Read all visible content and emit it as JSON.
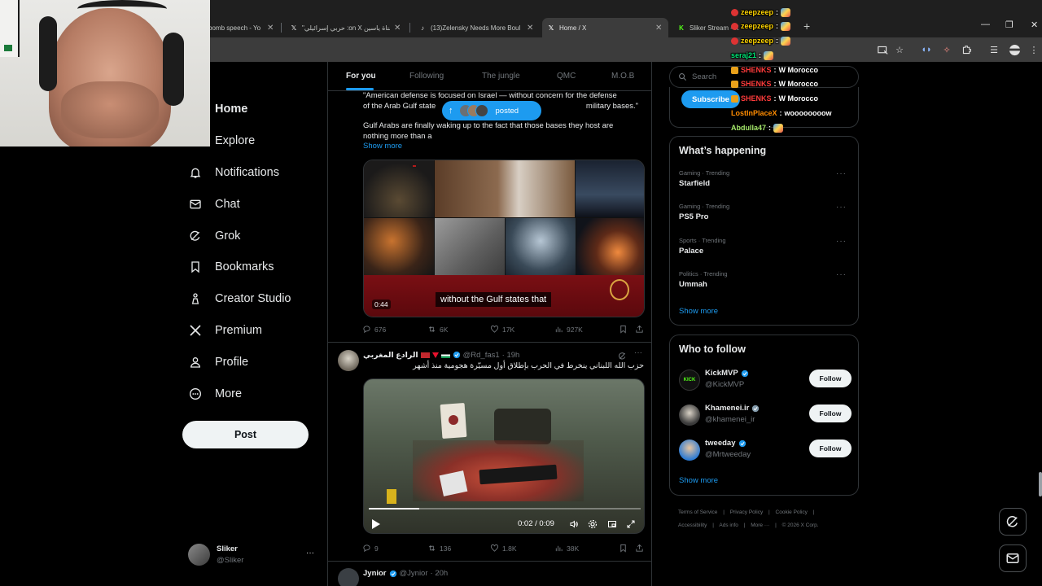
{
  "browser": {
    "tabs": [
      {
        "label": "bomb speech - Yo",
        "favicon": "youtube-icon"
      },
      {
        "label": "\"حربي إسرائيلي :on X قناة ياسين",
        "favicon": "x-icon"
      },
      {
        "label": "(13)Zelensky Needs More Boul",
        "favicon": "tiktok-icon"
      },
      {
        "label": "Home / X",
        "favicon": "x-icon"
      },
      {
        "label": "Sliker Stream - K",
        "favicon": "kick-icon"
      }
    ]
  },
  "nav": {
    "items": [
      {
        "label": "Home",
        "icon": "home-icon"
      },
      {
        "label": "Explore",
        "icon": "search-icon"
      },
      {
        "label": "Notifications",
        "icon": "bell-icon"
      },
      {
        "label": "Chat",
        "icon": "mail-icon"
      },
      {
        "label": "Grok",
        "icon": "grok-icon"
      },
      {
        "label": "Bookmarks",
        "icon": "bookmark-icon"
      },
      {
        "label": "Creator Studio",
        "icon": "creator-studio-icon"
      },
      {
        "label": "Premium",
        "icon": "x-premium-icon"
      },
      {
        "label": "Profile",
        "icon": "person-icon"
      },
      {
        "label": "More",
        "icon": "more-circle-icon"
      }
    ],
    "post_label": "Post",
    "account": {
      "name": "Sliker",
      "handle": "@Sliker",
      "more": "···"
    }
  },
  "feed": {
    "tabs": [
      "For you",
      "Following",
      "The jungle",
      "QMC",
      "M.O.B"
    ],
    "posted_pill": "posted",
    "tweet1": {
      "quote_line1": "\"American defense is focused on Israel — without concern for the defense",
      "quote_line2a": "of the Arab Gulf state",
      "quote_line2b": "military bases.\"",
      "body_line1": "Gulf Arabs are finally waking up to the fact that those bases they host are",
      "body_line2": "nothing more than a",
      "show_more": "Show more",
      "video_time": "0:44",
      "subtitle": "without the Gulf states that",
      "stats": {
        "replies": "676",
        "reposts": "6K",
        "likes": "17K",
        "views": "927K"
      }
    },
    "tweet2": {
      "author": "الرادع المغربي",
      "handle": "@Rd_fas1",
      "time": "· 19h",
      "text": "حزب الله اللبناني ينخرط في الحرب بإطلاق أول مسيّرة هجومية منذ أشهر",
      "video_time": "0:02 / 0:09",
      "stats": {
        "replies": "9",
        "reposts": "136",
        "likes": "1.8K",
        "views": "38K"
      }
    },
    "tweet3": {
      "author": "Jynior",
      "handle": "@Jynior",
      "time": "· 20h"
    }
  },
  "right": {
    "search_placeholder": "Search",
    "subscribe_label": "Subscribe",
    "happening_title": "What’s happening",
    "trends": [
      {
        "meta": "Gaming · Trending",
        "name": "Starfield"
      },
      {
        "meta": "Gaming · Trending",
        "name": "PS5 Pro"
      },
      {
        "meta": "Sports · Trending",
        "name": "Palace"
      },
      {
        "meta": "Politics · Trending",
        "name": "Ummah"
      }
    ],
    "trend_more": "···",
    "show_more": "Show more",
    "wtf_title": "Who to follow",
    "follow_label": "Follow",
    "who_to_follow": [
      {
        "name": "KickMVP",
        "handle": "@KickMVP",
        "badge": "blue"
      },
      {
        "name": "Khamenei.ir",
        "handle": "@khamenei_ir",
        "badge": "gray"
      },
      {
        "name": "tweeday",
        "handle": "@Mrtweeday",
        "badge": "blue"
      }
    ],
    "footer": {
      "line1": [
        "Terms of Service",
        "|",
        "Privacy Policy",
        "|",
        "Cookie Policy",
        "|"
      ],
      "line2": [
        "Accessibility",
        "|",
        "Ads info",
        "|",
        "More ···",
        "|",
        "© 2026 X Corp."
      ]
    }
  },
  "stream_chat": [
    {
      "user": "zeepzeep",
      "color": "#ffd400",
      "msg": ""
    },
    {
      "user": "zeepzeep",
      "color": "#ffd400",
      "msg": ""
    },
    {
      "user": "zeepzeep",
      "color": "#ffd400",
      "msg": ""
    },
    {
      "user": "seraj21",
      "color": "#00e676",
      "msg": ""
    },
    {
      "user": "SHENKS",
      "color": "#ff3b3b",
      "msg": "W Morocco"
    },
    {
      "user": "SHENKS",
      "color": "#ff3b3b",
      "msg": "W Morocco"
    },
    {
      "user": "SHENKS",
      "color": "#ff3b3b",
      "msg": "W Morocco"
    },
    {
      "user": "LostInPlaceX",
      "color": "#ff8c00",
      "msg": "woooooooow"
    },
    {
      "user": "Abdulla47",
      "color": "#a4e86a",
      "msg": ""
    }
  ],
  "colors": {
    "accent": "#1d9bf0",
    "bg": "#000000",
    "border": "#2f3336",
    "muted": "#71767b"
  }
}
